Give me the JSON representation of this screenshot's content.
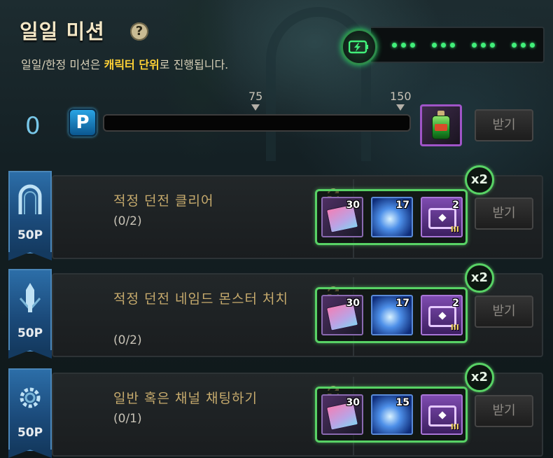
{
  "header": {
    "title": "일일 미션",
    "help_icon": "?",
    "subtitle_pre": "일일/한정 미션은 ",
    "subtitle_highlight": "캐릭터 단위",
    "subtitle_post": "로 진행됩니다."
  },
  "energy": {
    "icon": "battery-charge-icon",
    "segments": 4,
    "color": "#41f07a"
  },
  "progress": {
    "current_points": "0",
    "points_icon": "P",
    "max": 150,
    "fill_fraction": 0,
    "markers": [
      "75",
      "150"
    ],
    "bonus_reward_icon": "potion-icon",
    "claim_label": "받기"
  },
  "missions": [
    {
      "points": "50P",
      "badge_icon": "gate-icon",
      "name": "적정 던전 클리어",
      "progress": "(0/2)",
      "multiplier": "x2",
      "claim_label": "받기",
      "rewards": [
        {
          "icon": "book-icon",
          "count": "30"
        },
        {
          "icon": "crystal-icon",
          "count": "17"
        },
        {
          "icon": "chest-icon",
          "count": "2",
          "tier": "III"
        }
      ]
    },
    {
      "points": "50P",
      "badge_icon": "sword-icon",
      "name": "적정 던전 네임드 몬스터 처치",
      "progress": "(0/2)",
      "multiplier": "x2",
      "claim_label": "받기",
      "rewards": [
        {
          "icon": "book-icon",
          "count": "30"
        },
        {
          "icon": "crystal-icon",
          "count": "17"
        },
        {
          "icon": "chest-icon",
          "count": "2",
          "tier": "III"
        }
      ]
    },
    {
      "points": "50P",
      "badge_icon": "gear-icon",
      "name": "일반 혹은 채널 채팅하기",
      "progress": "(0/1)",
      "multiplier": "x2",
      "claim_label": "받기",
      "rewards": [
        {
          "icon": "book-icon",
          "count": "30"
        },
        {
          "icon": "crystal-icon",
          "count": "15"
        },
        {
          "icon": "chest-icon",
          "count": "",
          "tier": "III"
        }
      ]
    }
  ]
}
